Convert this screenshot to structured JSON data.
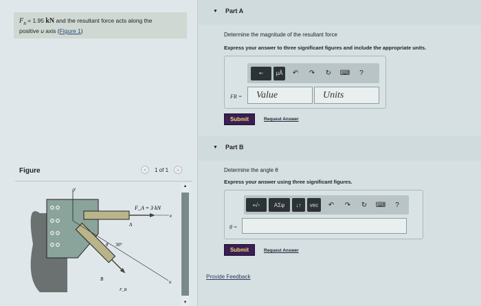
{
  "problem": {
    "var": "F",
    "sub": "B",
    "eq": " = 1.95 ",
    "unit": "kN",
    "text1": " and the resultant force acts along the",
    "text2a": "positive ",
    "axis": "u",
    "text2b": " axis (",
    "link": "Figure 1",
    "text2c": ")"
  },
  "figure": {
    "title": "Figure",
    "pager": "1 of 1",
    "prev": "<",
    "next": ">",
    "labels": {
      "y": "y",
      "x": "x",
      "u": "u",
      "FA": "F_A = 3 kN",
      "A": "A",
      "B": "B",
      "theta": "θ",
      "angle": "30°",
      "FB": "F_B"
    }
  },
  "partA": {
    "label": "Part A",
    "question": "Determine the magnitude of the resultant force",
    "instruction": "Express your answer to three significant figures and include the appropriate units.",
    "var_label": "FR =",
    "value_placeholder": "Value",
    "units_placeholder": "Units",
    "tool_mu": "μÅ",
    "help": "?",
    "submit": "Submit",
    "request": "Request Answer"
  },
  "partB": {
    "label": "Part B",
    "question": "Determine the angle θ",
    "instruction": "Express your answer using three significant figures.",
    "var_label": "θ =",
    "tool_greek": "ΑΣφ",
    "tool_vec": "vec",
    "tool_sub": "↓↑",
    "help": "?",
    "submit": "Submit",
    "request": "Request Answer"
  },
  "feedback": "Provide Feedback"
}
